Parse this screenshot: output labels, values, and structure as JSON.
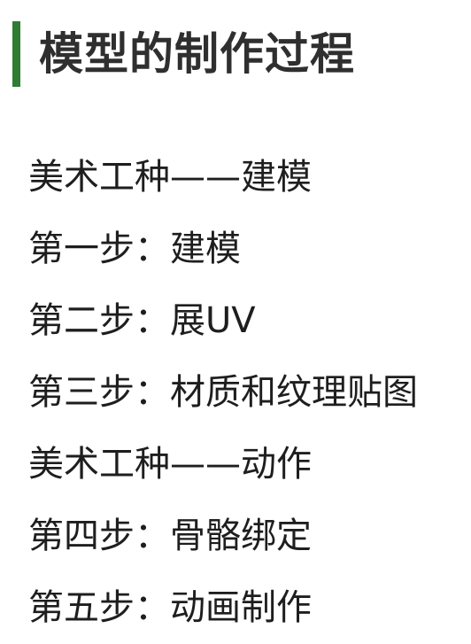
{
  "title": "模型的制作过程",
  "accent_color": "#2e7d32",
  "lines": [
    "美术工种——建模",
    "第一步：建模",
    "第二步：展UV",
    "第三步：材质和纹理贴图",
    "美术工种——动作",
    "第四步：骨骼绑定",
    "第五步：动画制作"
  ]
}
